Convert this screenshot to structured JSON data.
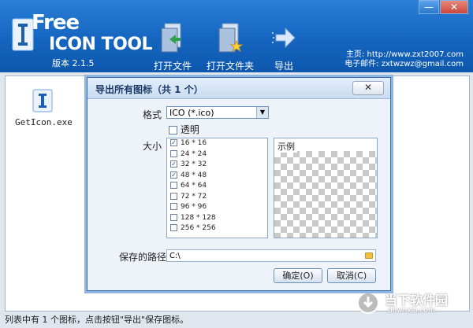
{
  "app": {
    "logo_title": "Free",
    "logo_subtitle": "ICON TOOL",
    "version": "版本 2.1.5"
  },
  "window_controls": {
    "minimize": "—",
    "close": "✕"
  },
  "toolbar": [
    {
      "label": "打开文件",
      "icon": "open-file-icon"
    },
    {
      "label": "打开文件夹",
      "icon": "open-folder-icon"
    },
    {
      "label": "导出",
      "icon": "export-arrow-icon"
    }
  ],
  "links": {
    "homepage": "主页: http://www.zxt2007.com",
    "email": "电子邮件: zxtwzwz@gmail.com"
  },
  "files": [
    {
      "name": "GetIcon.exe",
      "icon": "icon-file-icon"
    }
  ],
  "dialog": {
    "title": "导出所有图标（共 1 个）",
    "close": "✕",
    "format_label": "格式",
    "format_value": "ICO (*.ico)",
    "transparent_label": "透明",
    "transparent_checked": false,
    "size_label": "大小",
    "sizes": [
      {
        "label": "16 * 16",
        "checked": true
      },
      {
        "label": "24 * 24",
        "checked": false
      },
      {
        "label": "32 * 32",
        "checked": true
      },
      {
        "label": "48 * 48",
        "checked": true
      },
      {
        "label": "64 * 64",
        "checked": false
      },
      {
        "label": "72 * 72",
        "checked": false
      },
      {
        "label": "96 * 96",
        "checked": false
      },
      {
        "label": "128 * 128",
        "checked": false
      },
      {
        "label": "256 * 256",
        "checked": false
      }
    ],
    "preview_label": "示例",
    "path_label": "保存的路径",
    "path_value": "C:\\",
    "ok": "确定(O)",
    "cancel": "取消(C)"
  },
  "status": "列表中有 1 个图标，点击按钮\"导出\"保存图标。",
  "watermark": {
    "name": "当下软件园",
    "url": "downxia.com"
  },
  "colors": {
    "header": "#1565c0",
    "dialog_title": "#1d3a66",
    "accent": "#3a6fb0"
  }
}
